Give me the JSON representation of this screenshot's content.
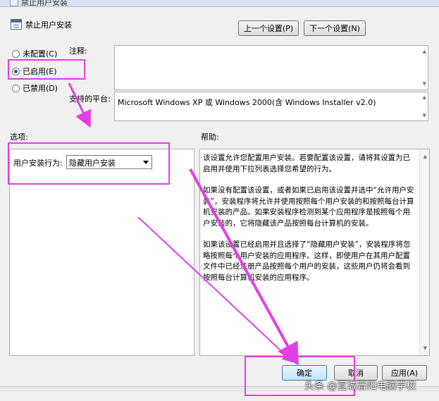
{
  "window": {
    "title": "禁止用户安装"
  },
  "policy": {
    "title": "禁止用户安装"
  },
  "nav": {
    "prev_label": "上一个设置(P)",
    "next_label": "下一个设置(N)"
  },
  "state": {
    "options": [
      {
        "label": "未配置(C)",
        "checked": false
      },
      {
        "label": "已启用(E)",
        "checked": true
      },
      {
        "label": "已禁用(D)",
        "checked": false
      }
    ]
  },
  "comment": {
    "label": "注释:",
    "value": ""
  },
  "platform": {
    "label": "支持的平台:",
    "value": "Microsoft Windows XP 或 Windows 2000(含 Windows Installer v2.0)"
  },
  "options_section": {
    "label": "选项:",
    "field_label": "用户安装行为:",
    "selected": "隐藏用户安装"
  },
  "help_section": {
    "label": "帮助:",
    "paragraphs": [
      "该设置允许您配置用户安装。若要配置该设置，请将其设置为已启用并使用下拉列表选择您希望的行为。",
      "如果没有配置该设置，或者如果已启用该设置并选中“允许用户安装”，安装程序将允许并使用按照每个用户安装的和按照每台计算机安装的产品。如果安装程序检测到某个应用程序是按照每个用户安装的，它将隐藏该产品按照每台计算机的安装。",
      "如果该设置已经启用并且选择了“隐藏用户安装”，安装程序将忽略按照每个用户安装的应用程序。这样，即使用户在其用户配置文件中已经注册产品按照每个用户的安装，这些用户仍将会看到按照每台计算机安装的应用程序。"
    ]
  },
  "footer": {
    "ok_label": "确定",
    "cancel_label": "取消",
    "apply_label": "应用(A)"
  },
  "watermark": "头条 @宣城晋阳电脑学校",
  "colors": {
    "highlight": "#e23fe6",
    "arrow": "#e23fe6"
  }
}
